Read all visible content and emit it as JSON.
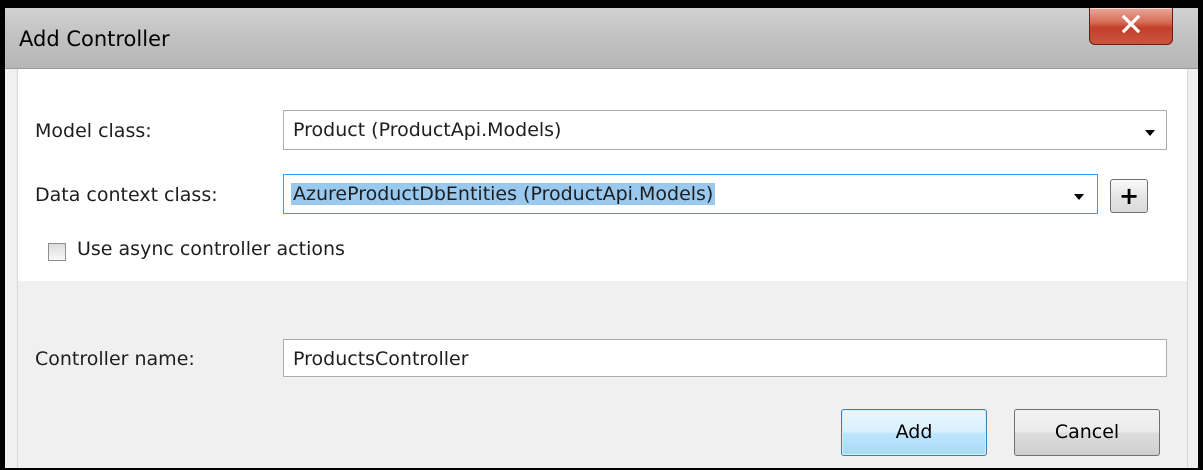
{
  "dialog": {
    "title": "Add Controller",
    "close_glyph": "x"
  },
  "model_class": {
    "label": "Model class:",
    "value": "Product (ProductApi.Models)"
  },
  "data_context_class": {
    "label": "Data context class:",
    "value": "AzureProductDbEntities (ProductApi.Models)",
    "add_button_label": "+"
  },
  "async_option": {
    "label": "Use async controller actions",
    "checked": false
  },
  "controller_name": {
    "label": "Controller name:",
    "value": "ProductsController"
  },
  "buttons": {
    "add": "Add",
    "cancel": "Cancel"
  },
  "colors": {
    "close_button": "#c8553f",
    "selection_highlight": "#99c9ef",
    "default_button": "#bee6fd"
  },
  "icons": {
    "close": "close-icon",
    "dropdown": "chevron-down-icon",
    "add": "plus-icon"
  }
}
